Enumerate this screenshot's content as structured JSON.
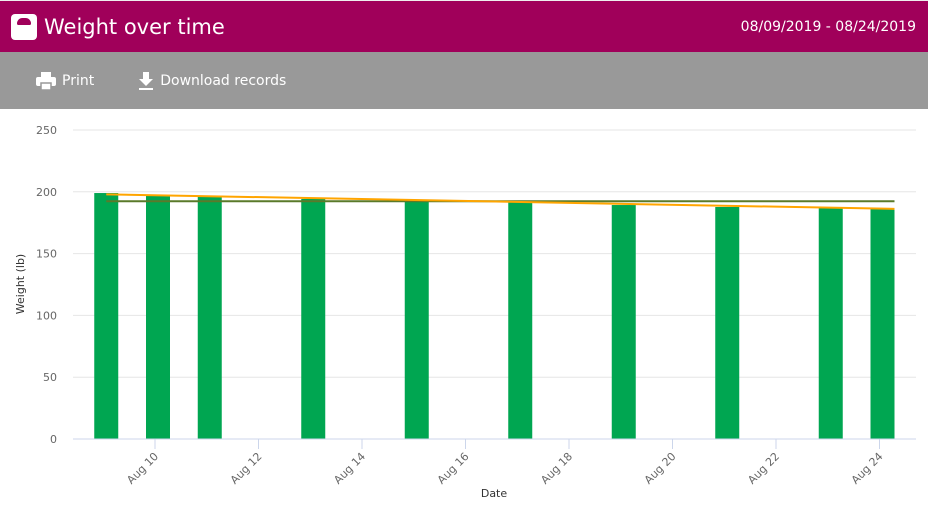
{
  "header": {
    "title": "Weight over time",
    "date_range": "08/09/2019 - 08/24/2019",
    "icon": "scale-icon"
  },
  "toolbar": {
    "print_label": "Print",
    "download_label": "Download records"
  },
  "colors": {
    "header": "#a0005a",
    "toolbar": "#999999",
    "bar": "#00a651",
    "trend": "#ffa500",
    "average": "#5a7a2a"
  },
  "chart_data": {
    "type": "bar",
    "xlabel": "Date",
    "ylabel": "Weight (lb)",
    "ylim": [
      0,
      250
    ],
    "yticks": [
      0,
      50,
      100,
      150,
      200,
      250
    ],
    "xticks": [
      "Aug 10",
      "Aug 12",
      "Aug 14",
      "Aug 16",
      "Aug 18",
      "Aug 20",
      "Aug 22",
      "Aug 24"
    ],
    "grid": true,
    "categories": [
      "Aug 9",
      "Aug 10",
      "Aug 11",
      "Aug 13",
      "Aug 15",
      "Aug 17",
      "Aug 19",
      "Aug 21",
      "Aug 23",
      "Aug 24"
    ],
    "day_of_month": [
      9,
      10,
      11,
      13,
      15,
      17,
      19,
      21,
      23,
      24
    ],
    "values": [
      199.0,
      197.4,
      195.8,
      194.2,
      193.4,
      191.7,
      189.3,
      187.7,
      187.7,
      186.9
    ],
    "overlays": [
      "linear trend line",
      "average line"
    ]
  }
}
